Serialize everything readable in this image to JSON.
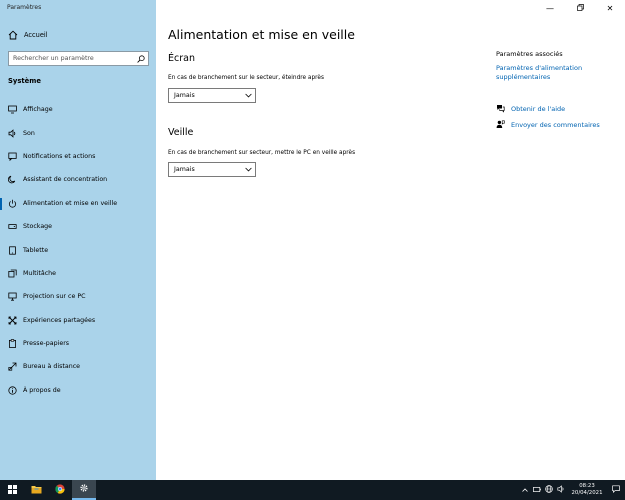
{
  "window": {
    "title": "Paramètres"
  },
  "sidebar": {
    "home_label": "Accueil",
    "search_placeholder": "Rechercher un paramètre",
    "section_title": "Système",
    "items": [
      {
        "label": "Affichage",
        "icon": "display-icon"
      },
      {
        "label": "Son",
        "icon": "sound-icon"
      },
      {
        "label": "Notifications et actions",
        "icon": "notifications-icon"
      },
      {
        "label": "Assistant de concentration",
        "icon": "focus-assist-icon"
      },
      {
        "label": "Alimentation et mise en veille",
        "icon": "power-icon",
        "active": true
      },
      {
        "label": "Stockage",
        "icon": "storage-icon"
      },
      {
        "label": "Tablette",
        "icon": "tablet-icon"
      },
      {
        "label": "Multitâche",
        "icon": "multitasking-icon"
      },
      {
        "label": "Projection sur ce PC",
        "icon": "projection-icon"
      },
      {
        "label": "Expériences partagées",
        "icon": "shared-experiences-icon"
      },
      {
        "label": "Presse-papiers",
        "icon": "clipboard-icon"
      },
      {
        "label": "Bureau à distance",
        "icon": "remote-desktop-icon"
      },
      {
        "label": "À propos de",
        "icon": "about-icon"
      }
    ]
  },
  "main": {
    "title": "Alimentation et mise en veille",
    "screen": {
      "heading": "Écran",
      "description": "En cas de branchement sur le secteur, éteindre après",
      "value": "Jamais"
    },
    "sleep": {
      "heading": "Veille",
      "description": "En cas de branchement sur secteur, mettre le PC en veille après",
      "value": "Jamais"
    }
  },
  "related": {
    "title": "Paramètres associés",
    "link": "Paramètres d'alimentation supplémentaires",
    "help": "Obtenir de l'aide",
    "feedback": "Envoyer des commentaires"
  },
  "taskbar": {
    "time": "08:23",
    "date": "20/04/2021"
  },
  "colors": {
    "sidebar_bg": "#aad3ea",
    "accent": "#0063b1",
    "taskbar_bg": "#101a22"
  }
}
